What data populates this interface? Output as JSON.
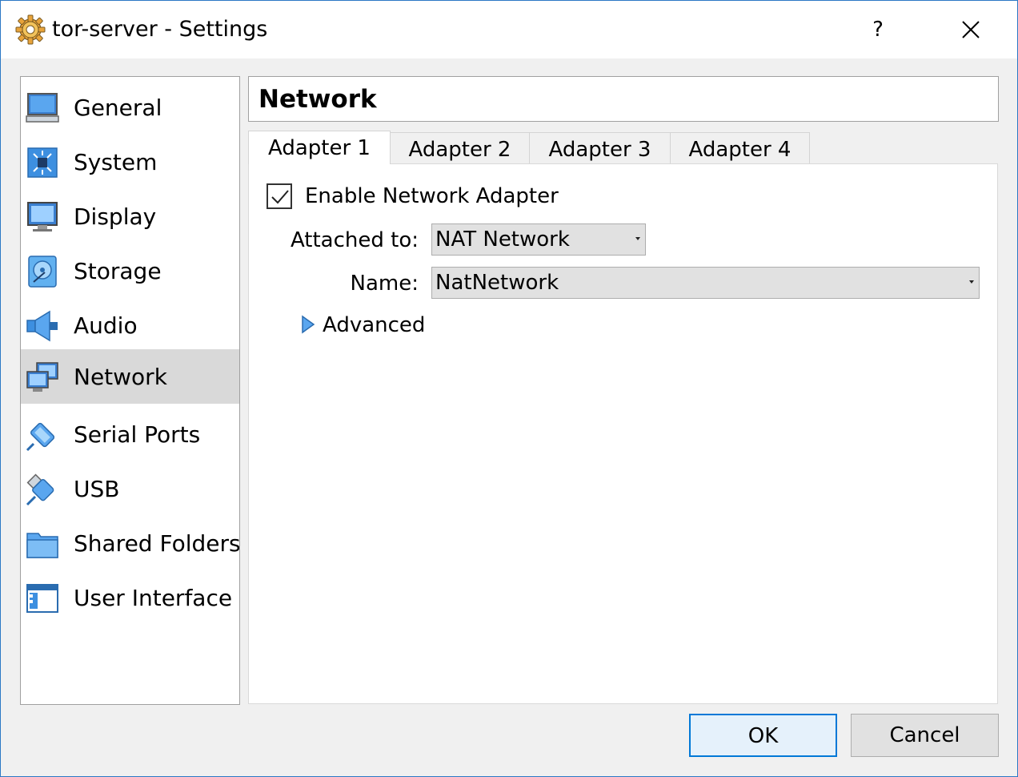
{
  "window": {
    "title": "tor-server - Settings",
    "help_label": "?",
    "accent_color": "#2b78c5"
  },
  "sidebar": {
    "items": [
      {
        "label": "General",
        "icon": "general-icon"
      },
      {
        "label": "System",
        "icon": "system-icon"
      },
      {
        "label": "Display",
        "icon": "display-icon"
      },
      {
        "label": "Storage",
        "icon": "storage-icon"
      },
      {
        "label": "Audio",
        "icon": "audio-icon"
      },
      {
        "label": "Network",
        "icon": "network-icon",
        "selected": true
      },
      {
        "label": "Serial Ports",
        "icon": "serial-ports-icon"
      },
      {
        "label": "USB",
        "icon": "usb-icon"
      },
      {
        "label": "Shared Folders",
        "icon": "shared-folders-icon"
      },
      {
        "label": "User Interface",
        "icon": "user-interface-icon"
      }
    ]
  },
  "page": {
    "title": "Network",
    "tabs": [
      {
        "label": "Adapter 1",
        "active": true
      },
      {
        "label": "Adapter 2"
      },
      {
        "label": "Adapter 3"
      },
      {
        "label": "Adapter 4"
      }
    ],
    "enable_label": "Enable Network Adapter",
    "enable_checked": true,
    "attached_label": "Attached to:",
    "attached_value": "NAT Network",
    "name_label": "Name:",
    "name_value": "NatNetwork",
    "advanced_label": "Advanced"
  },
  "buttons": {
    "ok": "OK",
    "cancel": "Cancel"
  }
}
